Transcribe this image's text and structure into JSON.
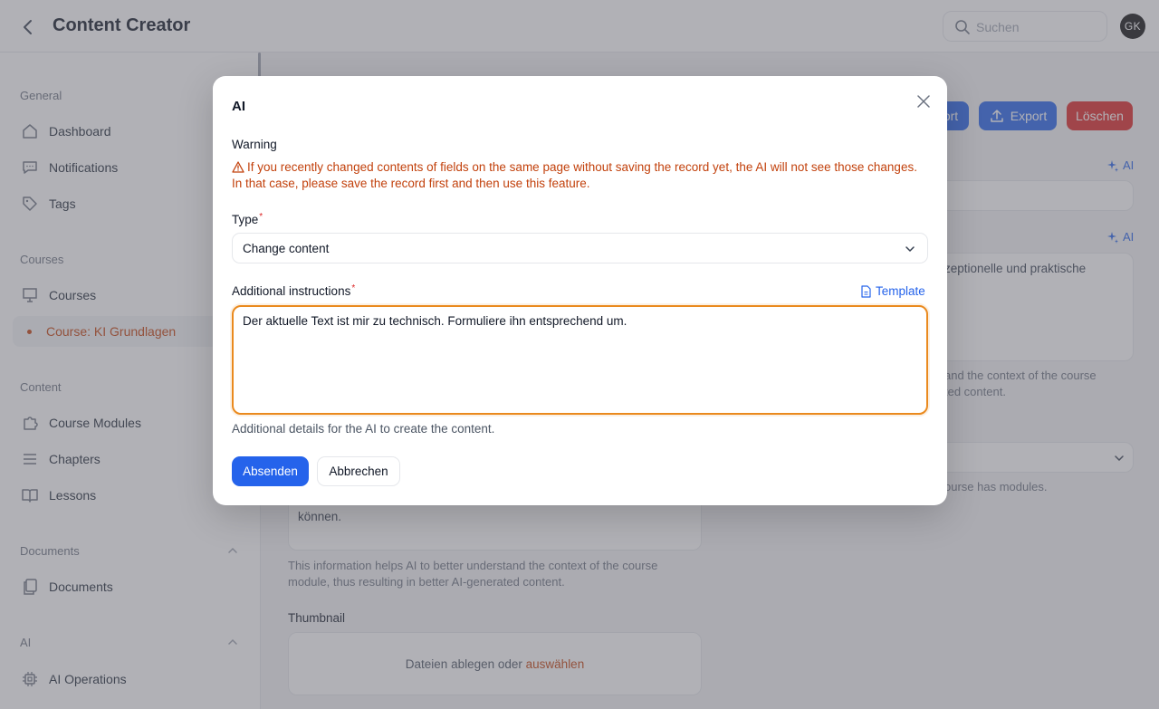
{
  "header": {
    "title": "Content Creator",
    "search_placeholder": "Suchen",
    "avatar_initials": "GK"
  },
  "sidebar": {
    "sections": [
      {
        "label": "General"
      },
      {
        "label": "Courses"
      },
      {
        "label": "Content"
      },
      {
        "label": "Documents"
      },
      {
        "label": "AI"
      }
    ],
    "items": {
      "dashboard": "Dashboard",
      "notifications": "Notifications",
      "tags": "Tags",
      "courses": "Courses",
      "course_ki": "Course: KI Grundlagen",
      "course_modules": "Course Modules",
      "chapters": "Chapters",
      "lessons": "Lessons",
      "documents": "Documents",
      "ai_operations": "AI Operations"
    }
  },
  "page": {
    "buttons": {
      "import_partial": "ort",
      "export": "Export",
      "delete": "Löschen"
    },
    "ai_label": "AI",
    "bg_text_1": "zeptionelle und praktische",
    "bg_help_1_line1": "and the context of the course",
    "bg_help_1_line2": "ted content.",
    "bg_help_2": "ourse has modules.",
    "bg_text_2": "können.",
    "bg_help_3_line1": "This information helps AI to better understand the context of the course",
    "bg_help_3_line2": "module, thus resulting in better AI-generated content.",
    "thumbnail_label": "Thumbnail",
    "dropzone_text": "Dateien ablegen oder",
    "dropzone_link": "auswählen"
  },
  "modal": {
    "title": "AI",
    "warning_title": "Warning",
    "warning_text": "If you recently changed contents of fields on the same page without saving the record yet, the AI will not see those changes. In that case, please save the record first and then use this feature.",
    "type_label": "Type",
    "type_value": "Change content",
    "instructions_label": "Additional instructions",
    "template_link": "Template",
    "instructions_value": "Der aktuelle Text ist mir zu technisch. Formuliere ihn entsprechend um.",
    "help_text": "Additional details for the AI to create the content.",
    "submit_label": "Absenden",
    "cancel_label": "Abbrechen"
  },
  "colors": {
    "accent": "#2563eb",
    "danger": "#dc2626",
    "warning": "#c2410c",
    "focus": "#ea8a1e"
  }
}
